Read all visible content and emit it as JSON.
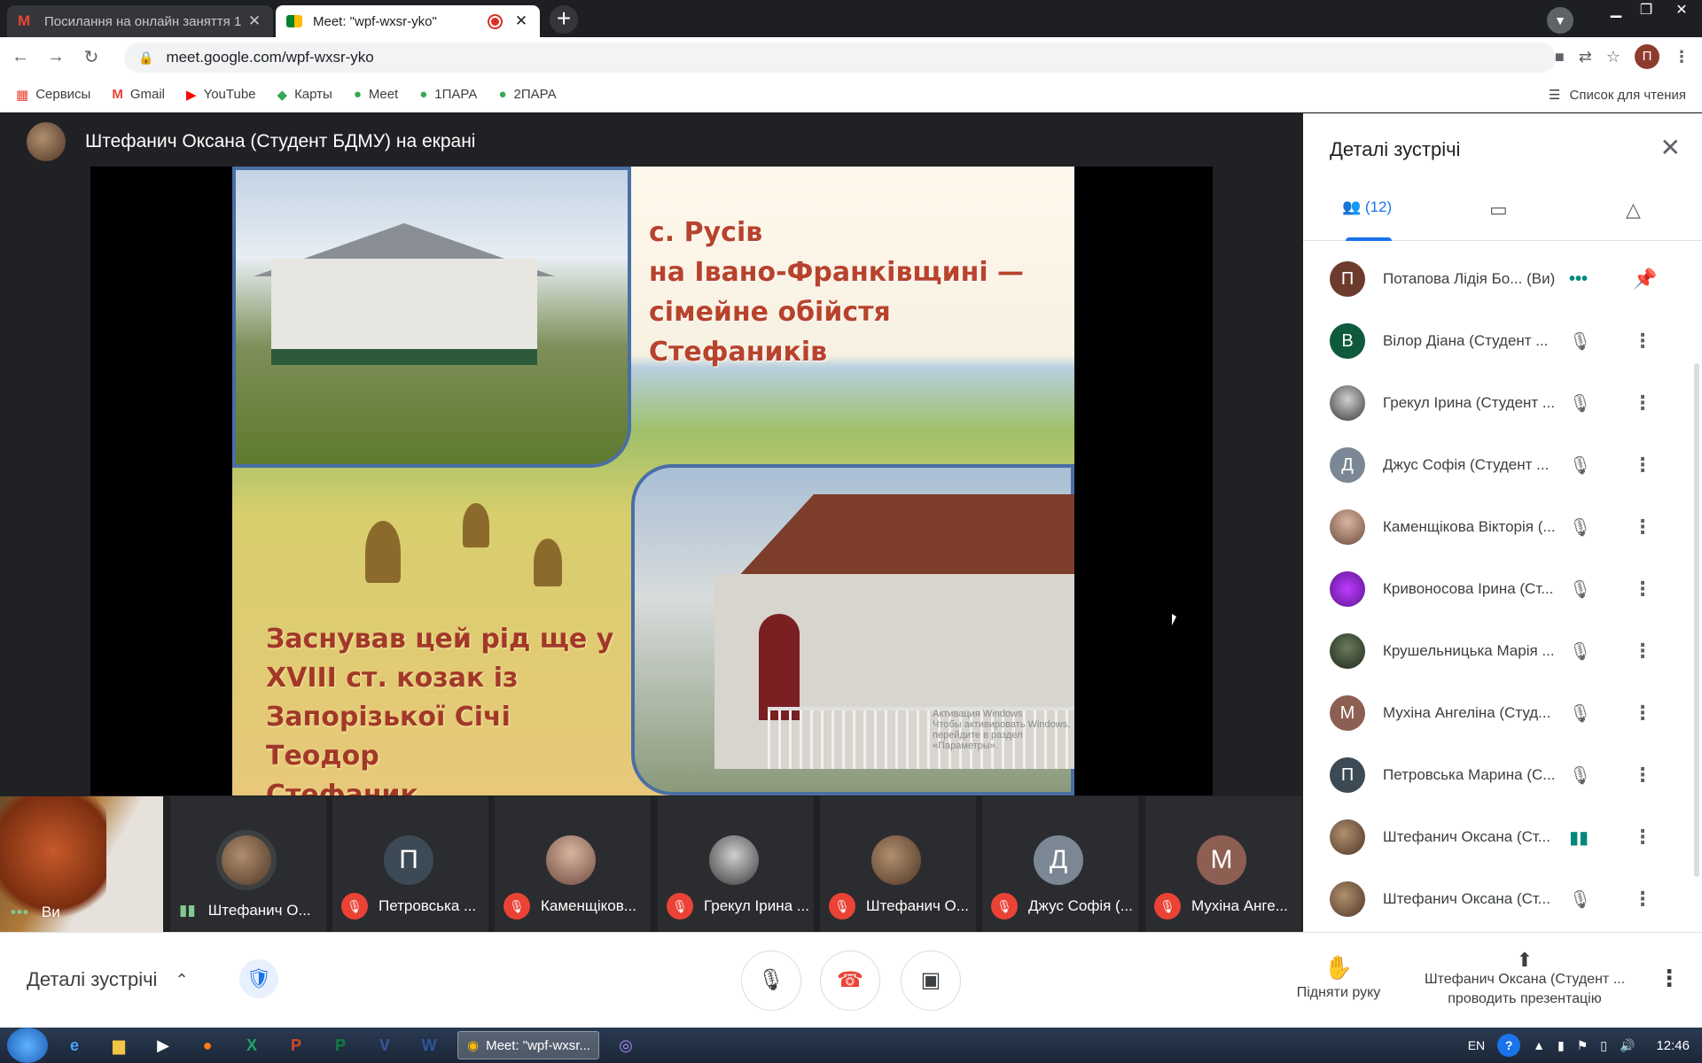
{
  "browser": {
    "tabs": [
      {
        "title": "Посилання на онлайн заняття 1",
        "favicon": "gmail-icon"
      },
      {
        "title": "Meet: \"wpf-wxsr-yko\"",
        "favicon": "meet-icon"
      }
    ],
    "url": "meet.google.com/wpf-wxsr-yko",
    "profile_initial": "П",
    "bookmarks": [
      "Сервисы",
      "Gmail",
      "YouTube",
      "Карты",
      "Meet",
      "1ПАРА",
      "2ПАРА"
    ],
    "reading_list": "Список для чтения"
  },
  "presenter": {
    "title": "Штефанич Оксана (Студент БДМУ) на екрані"
  },
  "slide": {
    "title_lines": [
      "с. Русів",
      "на Івано-Франківщині —",
      "сімейне обійстя Стефаників"
    ],
    "body_lines": [
      "Заснував цей рід ще у",
      "XVIII ст. козак із",
      "Запорізької Січі Теодор",
      "Стефаник"
    ],
    "watermark_1": "Активация Windows",
    "watermark_2": "Чтобы активировать Windows, перейдите в раздел",
    "watermark_3": "«Параметры»."
  },
  "filmstrip": {
    "self_label": "Ви",
    "tiles": [
      {
        "name": "Штефанич О...",
        "initial": "",
        "state": "speaking"
      },
      {
        "name": "Петровська ...",
        "initial": "П",
        "state": "muted",
        "color": "#3c4a55"
      },
      {
        "name": "Каменщіков...",
        "initial": "",
        "state": "muted"
      },
      {
        "name": "Грекул Ірина ...",
        "initial": "",
        "state": "muted"
      },
      {
        "name": "Штефанич О...",
        "initial": "",
        "state": "muted"
      },
      {
        "name": "Джус Софія (...",
        "initial": "Д",
        "state": "muted",
        "color": "#7b8794"
      },
      {
        "name": "Мухіна Анге...",
        "initial": "М",
        "state": "muted",
        "color": "#8d5f52"
      }
    ]
  },
  "panel": {
    "title": "Деталі зустрічі",
    "people_count": "(12)",
    "participants": [
      {
        "name": "Потапова Лідія Бо...  (Ви)",
        "initial": "П",
        "color": "#6d3b2e",
        "state": "self"
      },
      {
        "name": "Вілор Діана (Студент ...",
        "initial": "В",
        "color": "#0f5a3c",
        "state": "muted"
      },
      {
        "name": "Грекул Ірина (Студент ...",
        "initial": "",
        "color": "#8a8a8a",
        "state": "muted"
      },
      {
        "name": "Джус Софія (Студент ...",
        "initial": "Д",
        "color": "#7b8794",
        "state": "muted"
      },
      {
        "name": "Каменщікова Вікторія (...",
        "initial": "",
        "color": "#8f4a3c",
        "state": "muted"
      },
      {
        "name": "Кривоносова Ірина (Ст...",
        "initial": "",
        "color": "#8a2bc7",
        "state": "muted"
      },
      {
        "name": "Крушельницька Марія ...",
        "initial": "",
        "color": "#3a4a3a",
        "state": "muted"
      },
      {
        "name": "Мухіна Ангеліна (Студ...",
        "initial": "М",
        "color": "#8d5f52",
        "state": "muted"
      },
      {
        "name": "Петровська Марина (С...",
        "initial": "П",
        "color": "#3c4a55",
        "state": "muted"
      },
      {
        "name": "Штефанич Оксана (Ст...",
        "initial": "",
        "color": "#7a5a44",
        "state": "speaking"
      },
      {
        "name": "Штефанич Оксана (Ст...",
        "initial": "",
        "color": "#7a5a44",
        "state": "muted"
      }
    ]
  },
  "controls": {
    "details_label": "Деталі зустрічі",
    "raise_hand": "Підняти руку",
    "presenting_line1": "Штефанич Оксана (Студент ...",
    "presenting_line2": "проводить презентацію"
  },
  "taskbar": {
    "active_task": "Meet: \"wpf-wxsr...",
    "lang": "EN",
    "time": "12:46"
  },
  "colors": {
    "accent": "#1a73e8",
    "muted_red": "#ea4335",
    "speaking_green": "#81c995"
  }
}
